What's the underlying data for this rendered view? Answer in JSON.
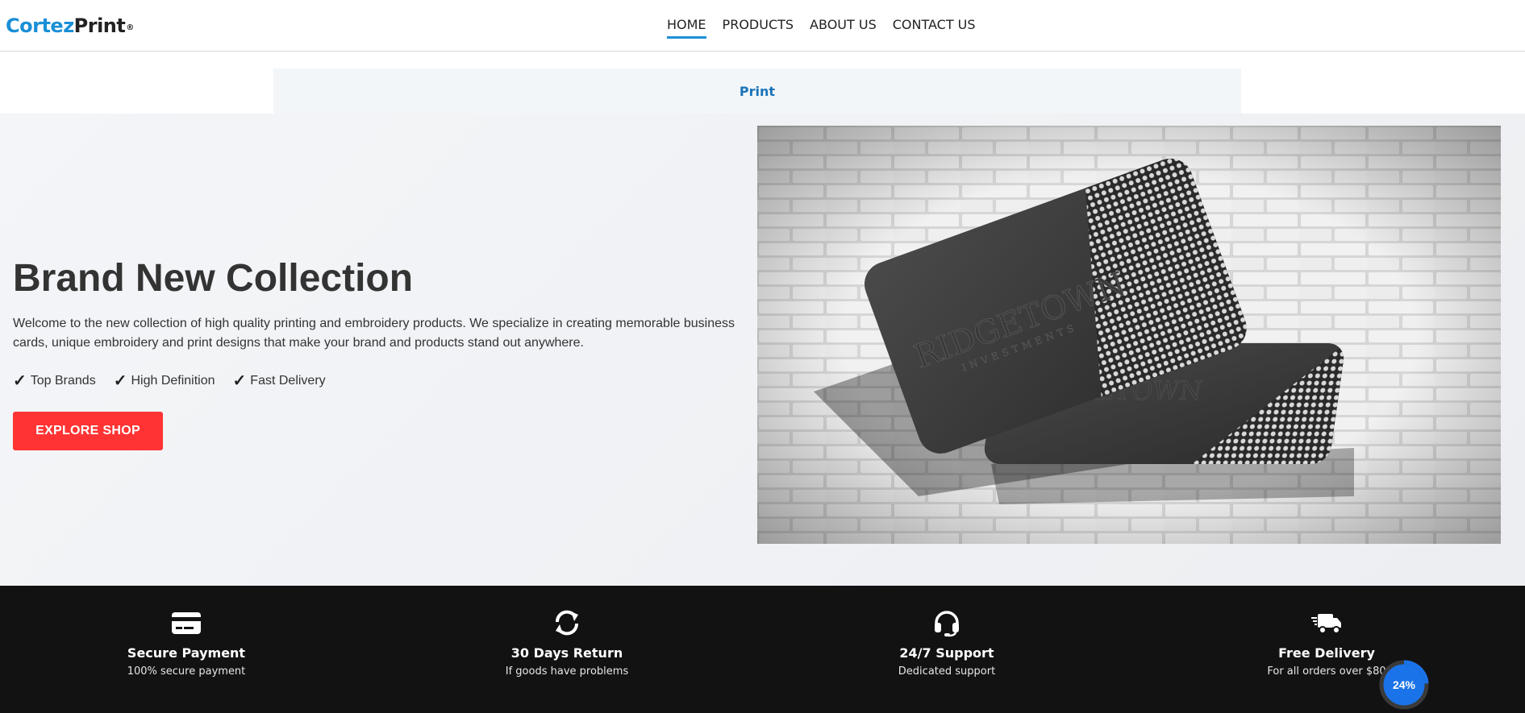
{
  "brand": {
    "part1": "Cortez",
    "part2": "Print",
    "mark": "®",
    "color_primary": "#1a8fd6"
  },
  "nav": [
    {
      "label": "HOME",
      "active": true
    },
    {
      "label": "PRODUCTS",
      "active": false
    },
    {
      "label": "ABOUT US",
      "active": false
    },
    {
      "label": "CONTACT US",
      "active": false
    }
  ],
  "subnav": {
    "label": "Print"
  },
  "hero": {
    "title": "Brand New Collection",
    "description": "Welcome to the new collection of high quality printing and embroidery products. We specialize in creating memorable business cards, unique embroidery and print designs that make your brand and products stand out anywhere.",
    "features": [
      "Top Brands",
      "High Definition",
      "Fast Delivery"
    ],
    "check_icon": "checkmark-icon",
    "cta_label": "EXPLORE SHOP",
    "cta_color": "#ff3333",
    "image": {
      "subject": "business-cards-photo",
      "card_text_main": "RIDGETOWN",
      "card_text_sub": "INVESTMENTS"
    }
  },
  "services": [
    {
      "icon": "credit-card-icon",
      "title": "Secure Payment",
      "subtitle": "100% secure payment"
    },
    {
      "icon": "refresh-icon",
      "title": "30 Days Return",
      "subtitle": "If goods have problems"
    },
    {
      "icon": "headset-icon",
      "title": "24/7 Support",
      "subtitle": "Dedicated support"
    },
    {
      "icon": "delivery-truck-icon",
      "title": "Free Delivery",
      "subtitle": "For all orders over $80"
    }
  ],
  "scroll_progress": {
    "label": "24%",
    "value": 0.24,
    "color": "#1a73e8"
  }
}
